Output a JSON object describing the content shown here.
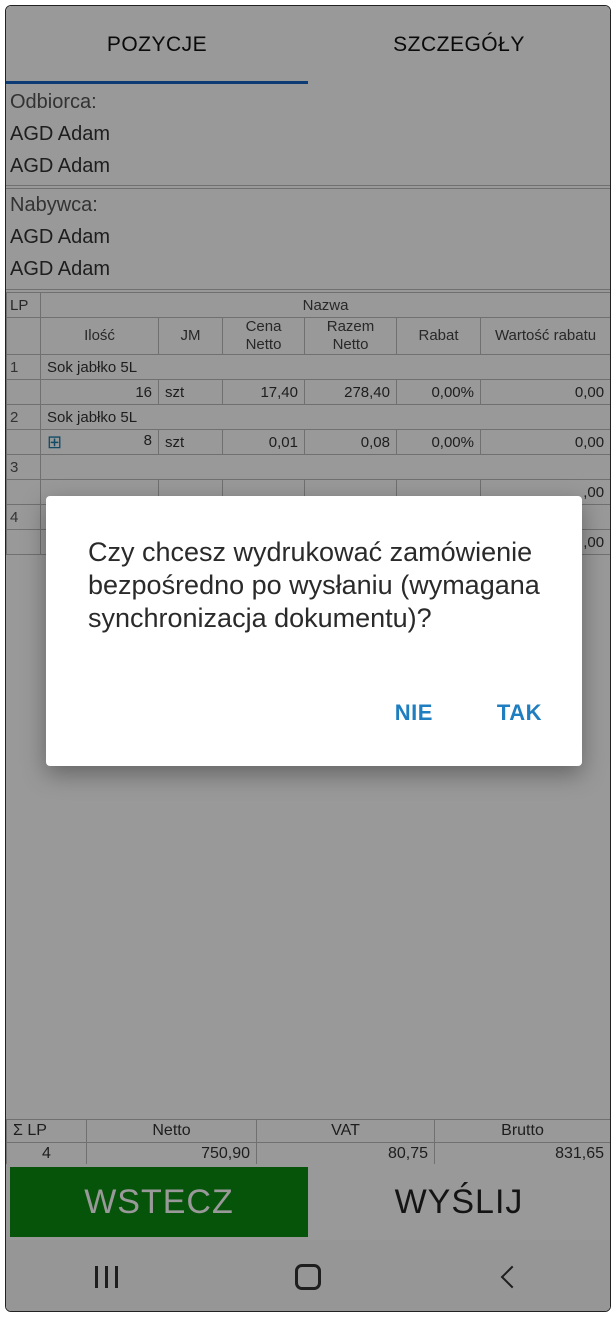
{
  "tabs": [
    "POZYCJE",
    "SZCZEGÓŁY"
  ],
  "odbiorca": {
    "label": "Odbiorca:",
    "line1": "AGD Adam",
    "line2": "AGD Adam"
  },
  "nabywca": {
    "label": "Nabywca:",
    "line1": "AGD Adam",
    "line2": "AGD Adam"
  },
  "table": {
    "headers": {
      "lp": "LP",
      "nazwa": "Nazwa",
      "ilosc": "Ilość",
      "jm": "JM",
      "cena_netto": "Cena Netto",
      "razem_netto": "Razem Netto",
      "rabat": "Rabat",
      "wartosc_rabatu": "Wartość rabatu"
    },
    "rows": [
      {
        "lp": "1",
        "nazwa": "Sok jabłko 5L",
        "ilosc": "16",
        "jm": "szt",
        "cena": "17,40",
        "razem": "278,40",
        "rabat": "0,00%",
        "wartosc": "0,00"
      },
      {
        "lp": "2",
        "nazwa": "Sok jabłko 5L",
        "ilosc": "8",
        "jm": "szt",
        "cena": "0,01",
        "razem": "0,08",
        "rabat": "0,00%",
        "wartosc": "0,00"
      },
      {
        "lp": "3",
        "nazwa": "",
        "ilosc": "",
        "jm": "",
        "cena": "",
        "razem": "",
        "rabat": "",
        "wartosc": ",00"
      },
      {
        "lp": "4",
        "nazwa": "",
        "ilosc": "",
        "jm": "",
        "cena": "",
        "razem": "",
        "rabat": "",
        "wartosc": ",00"
      }
    ]
  },
  "totals": {
    "headers": [
      "Σ LP",
      "Netto",
      "VAT",
      "Brutto"
    ],
    "values": [
      "4",
      "750,90",
      "80,75",
      "831,65"
    ]
  },
  "buttons": {
    "back": "WSTECZ",
    "send": "WYŚLIJ"
  },
  "dialog": {
    "message": "Czy chcesz wydrukować zamówienie bezpośredno po wysłaniu (wymagana synchronizacja dokumentu)?",
    "no": "NIE",
    "yes": "TAK"
  },
  "colors": {
    "accent": "#1565c0",
    "back_button": "#0a8a12",
    "dialog_action": "#1f7ec0"
  },
  "icons": {
    "gift": "gift-icon",
    "recent": "recent-apps-icon",
    "home": "home-icon",
    "back": "back-icon"
  }
}
